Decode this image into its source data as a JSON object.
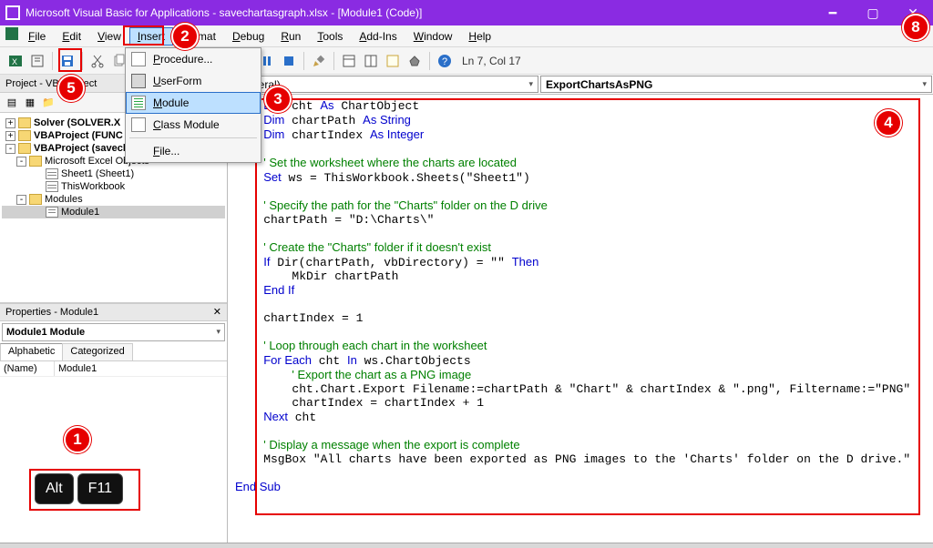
{
  "titlebar": {
    "text": "Microsoft Visual Basic for Applications - savechartasgraph.xlsx - [Module1 (Code)]"
  },
  "menubar": {
    "items": [
      "File",
      "Edit",
      "View",
      "Insert",
      "Format",
      "Debug",
      "Run",
      "Tools",
      "Add-Ins",
      "Window",
      "Help"
    ]
  },
  "insert_menu": {
    "items": [
      {
        "label": "Procedure...",
        "icon": "proc"
      },
      {
        "label": "UserForm",
        "icon": "uform"
      },
      {
        "label": "Module",
        "icon": "module",
        "selected": true
      },
      {
        "label": "Class Module",
        "icon": "cmod"
      },
      {
        "label": "File...",
        "icon": ""
      }
    ]
  },
  "toolbar": {
    "status": "Ln 7, Col 17"
  },
  "project": {
    "title": "Project - VBAProject",
    "nodes": [
      {
        "exp": "+",
        "bold": true,
        "icon": "folder",
        "text": "Solver (SOLVER.X",
        "indent": 0
      },
      {
        "exp": "+",
        "bold": true,
        "icon": "folder",
        "text": "VBAProject (FUNC",
        "indent": 0
      },
      {
        "exp": "-",
        "bold": true,
        "icon": "folder",
        "text": "VBAProject (savechartasgraph.",
        "indent": 0
      },
      {
        "exp": "-",
        "bold": false,
        "icon": "folder",
        "text": "Microsoft Excel Objects",
        "indent": 1
      },
      {
        "exp": "",
        "bold": false,
        "icon": "sheet",
        "text": "Sheet1 (Sheet1)",
        "indent": 2
      },
      {
        "exp": "",
        "bold": false,
        "icon": "sheet",
        "text": "ThisWorkbook",
        "indent": 2
      },
      {
        "exp": "-",
        "bold": false,
        "icon": "folder",
        "text": "Modules",
        "indent": 1
      },
      {
        "exp": "",
        "bold": false,
        "icon": "mod",
        "text": "Module1",
        "indent": 2,
        "selected": true
      }
    ]
  },
  "properties": {
    "title": "Properties - Module1",
    "combo": "Module1 Module",
    "tabs": [
      "Alphabetic",
      "Categorized"
    ],
    "rows": [
      {
        "name": "(Name)",
        "value": "Module1"
      }
    ]
  },
  "code_headers": {
    "left": "(General)",
    "right": "ExportChartsAsPNG"
  },
  "callouts": {
    "n1": "1",
    "n2": "2",
    "n3": "3",
    "n4": "4",
    "n5": "5",
    "n8": "8"
  },
  "keys": {
    "alt": "Alt",
    "f11": "F11"
  },
  "code_lines": [
    {
      "t": "    ",
      "k": "Dim",
      "r": " cht ",
      "k2": "As",
      "r2": " ChartObject"
    },
    {
      "t": "    ",
      "k": "Dim",
      "r": " chartPath ",
      "k2": "As String"
    },
    {
      "t": "    ",
      "k": "Dim",
      "r": " chartIndex ",
      "k2": "As Integer"
    },
    {
      "blank": true
    },
    {
      "t": "    ",
      "c": "' Set the worksheet where the charts are located"
    },
    {
      "t": "    ",
      "k": "Set",
      "r": " ws = ThisWorkbook.Sheets(\"Sheet1\")"
    },
    {
      "blank": true
    },
    {
      "t": "    ",
      "c": "' Specify the path for the \"Charts\" folder on the D drive"
    },
    {
      "t": "    ",
      "r": "chartPath = \"D:\\Charts\\\""
    },
    {
      "blank": true
    },
    {
      "t": "    ",
      "c": "' Create the \"Charts\" folder if it doesn't exist"
    },
    {
      "t": "    ",
      "k": "If",
      "r": " Dir(chartPath, vbDirectory) = \"\" ",
      "k2": "Then"
    },
    {
      "t": "        ",
      "r": "MkDir chartPath"
    },
    {
      "t": "    ",
      "k": "End If"
    },
    {
      "blank": true
    },
    {
      "t": "    ",
      "r": "chartIndex = 1"
    },
    {
      "blank": true
    },
    {
      "t": "    ",
      "c": "' Loop through each chart in the worksheet"
    },
    {
      "t": "    ",
      "k": "For Each",
      "r": " cht ",
      "k2": "In",
      "r2": " ws.ChartObjects"
    },
    {
      "t": "        ",
      "c": "' Export the chart as a PNG image"
    },
    {
      "t": "        ",
      "r": "cht.Chart.Export Filename:=chartPath & \"Chart\" & chartIndex & \".png\", Filtername:=\"PNG\""
    },
    {
      "t": "        ",
      "r": "chartIndex = chartIndex + 1"
    },
    {
      "t": "    ",
      "k": "Next",
      "r": " cht"
    },
    {
      "blank": true
    },
    {
      "t": "    ",
      "c": "' Display a message when the export is complete"
    },
    {
      "t": "    ",
      "r": "MsgBox \"All charts have been exported as PNG images to the 'Charts' folder on the D drive.\""
    },
    {
      "blank": true
    },
    {
      "t": "",
      "k": "End Sub"
    }
  ]
}
